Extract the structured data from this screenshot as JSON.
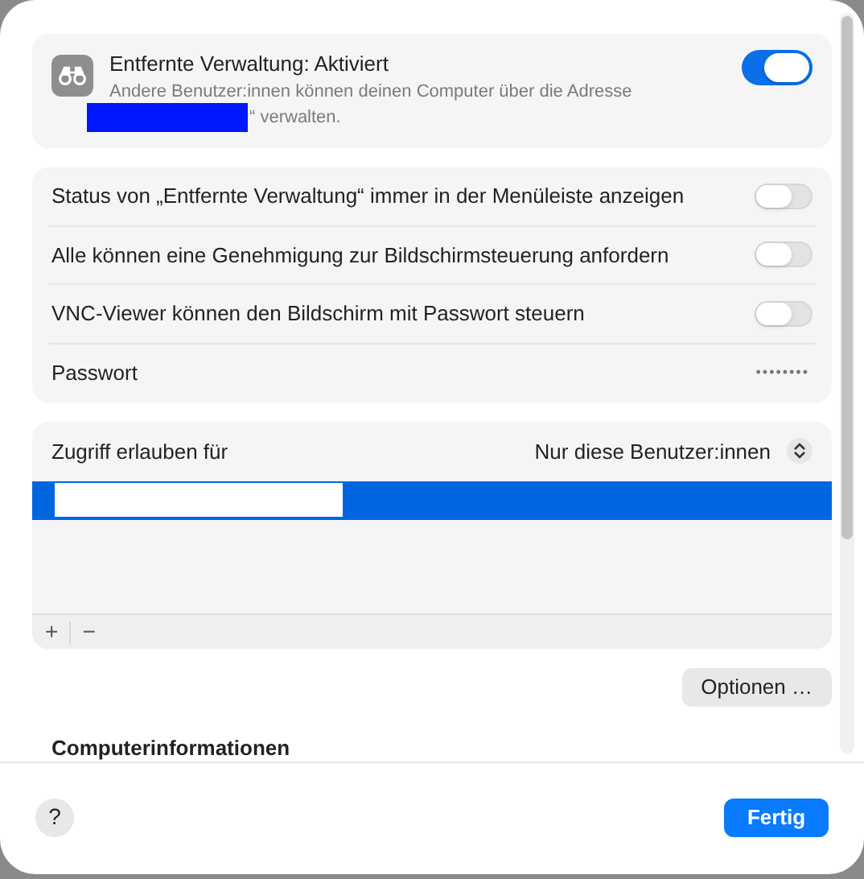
{
  "service": {
    "title": "Entfernte Verwaltung: Aktiviert",
    "description_before": "Andere Benutzer:innen können deinen Computer über die Adresse",
    "description_after": "“ verwalten.",
    "on": true
  },
  "settings": [
    {
      "kind": "toggle",
      "label": "Status von „Entfernte Verwaltung“ immer in der Menüleiste anzeigen",
      "on": false
    },
    {
      "kind": "toggle",
      "label": "Alle können eine Genehmigung zur Bildschirmsteuerung anfordern",
      "on": false
    },
    {
      "kind": "toggle",
      "label": "VNC-Viewer können den Bildschirm mit Passwort steuern",
      "on": false
    },
    {
      "kind": "password",
      "label": "Passwort",
      "value": "••••••••"
    }
  ],
  "access": {
    "label": "Zugriff erlauben für",
    "choice": "Nur diese Benutzer:innen",
    "users": [
      {
        "selected": true
      }
    ],
    "add": "+",
    "remove": "−"
  },
  "options_button": "Optionen …",
  "section_heading": "Computerinformationen",
  "help_button": "?",
  "done_button": "Fertig"
}
